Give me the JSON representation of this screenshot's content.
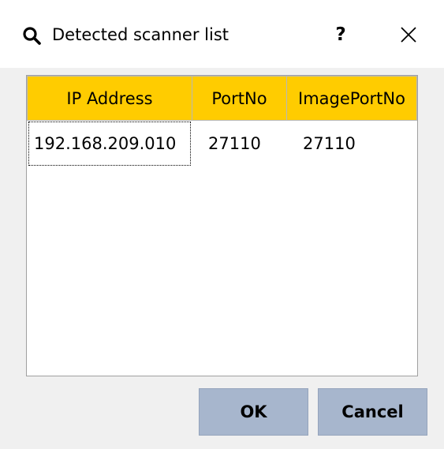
{
  "window": {
    "title": "Detected scanner list",
    "help_label": "?",
    "icons": {
      "title_icon": "search-icon",
      "close": "close-icon"
    }
  },
  "table": {
    "columns": [
      "IP Address",
      "PortNo",
      "ImagePortNo"
    ],
    "rows": [
      [
        "192.168.209.010",
        "27110",
        "27110"
      ]
    ],
    "header_color": "#ffcc00"
  },
  "buttons": {
    "ok": "OK",
    "cancel": "Cancel",
    "color": "#a7b6cd"
  }
}
